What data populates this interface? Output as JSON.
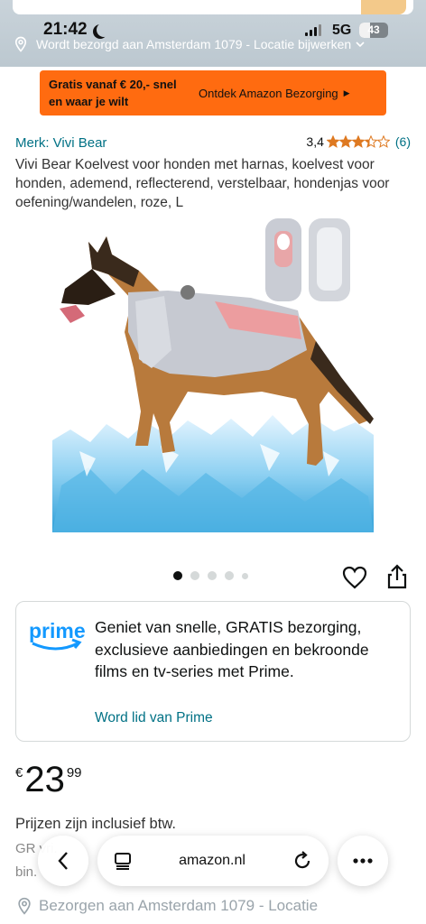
{
  "status_bar": {
    "time": "21:42",
    "network": "5G",
    "battery": "43"
  },
  "location_bar": {
    "text": "Wordt bezorgd aan Amsterdam 1079 - Locatie bijwerken"
  },
  "promo": {
    "left_text": "Gratis vanaf € 20,- snel en waar je wilt",
    "right_text": "Ontdek Amazon Bezorging",
    "arrow": "▶"
  },
  "product": {
    "brand": "Merk: Vivi Bear",
    "rating_value": "3,4",
    "stars": 3.4,
    "rating_count": "(6)",
    "title": "Vivi Bear Koelvest voor honden met harnas, koelvest voor honden, ademend, reflecterend, verstelbaar, hondenjas voor oefening/wandelen, roze, L",
    "image_count": 5,
    "active_image": 1
  },
  "prime": {
    "logo_text": "prime",
    "text": "Geniet van snelle, GRATIS bezorging, exclusieve aanbiedingen en bekroonde films en tv-series met Prime.",
    "link": "Word lid van Prime"
  },
  "price": {
    "currency": "€",
    "whole": "23",
    "fraction": "99",
    "tax_note": "Prijzen zijn inclusief btw."
  },
  "faded": {
    "line1": "GR                                                          vri.",
    "line2": "bin.",
    "delivery": "Bezorgen aan Amsterdam 1079 - Locatie"
  },
  "browser": {
    "url": "amazon.nl"
  },
  "colors": {
    "promo": "#ff6b10",
    "link": "#007185",
    "star": "#de7921",
    "prime_blue": "#1399ff"
  }
}
